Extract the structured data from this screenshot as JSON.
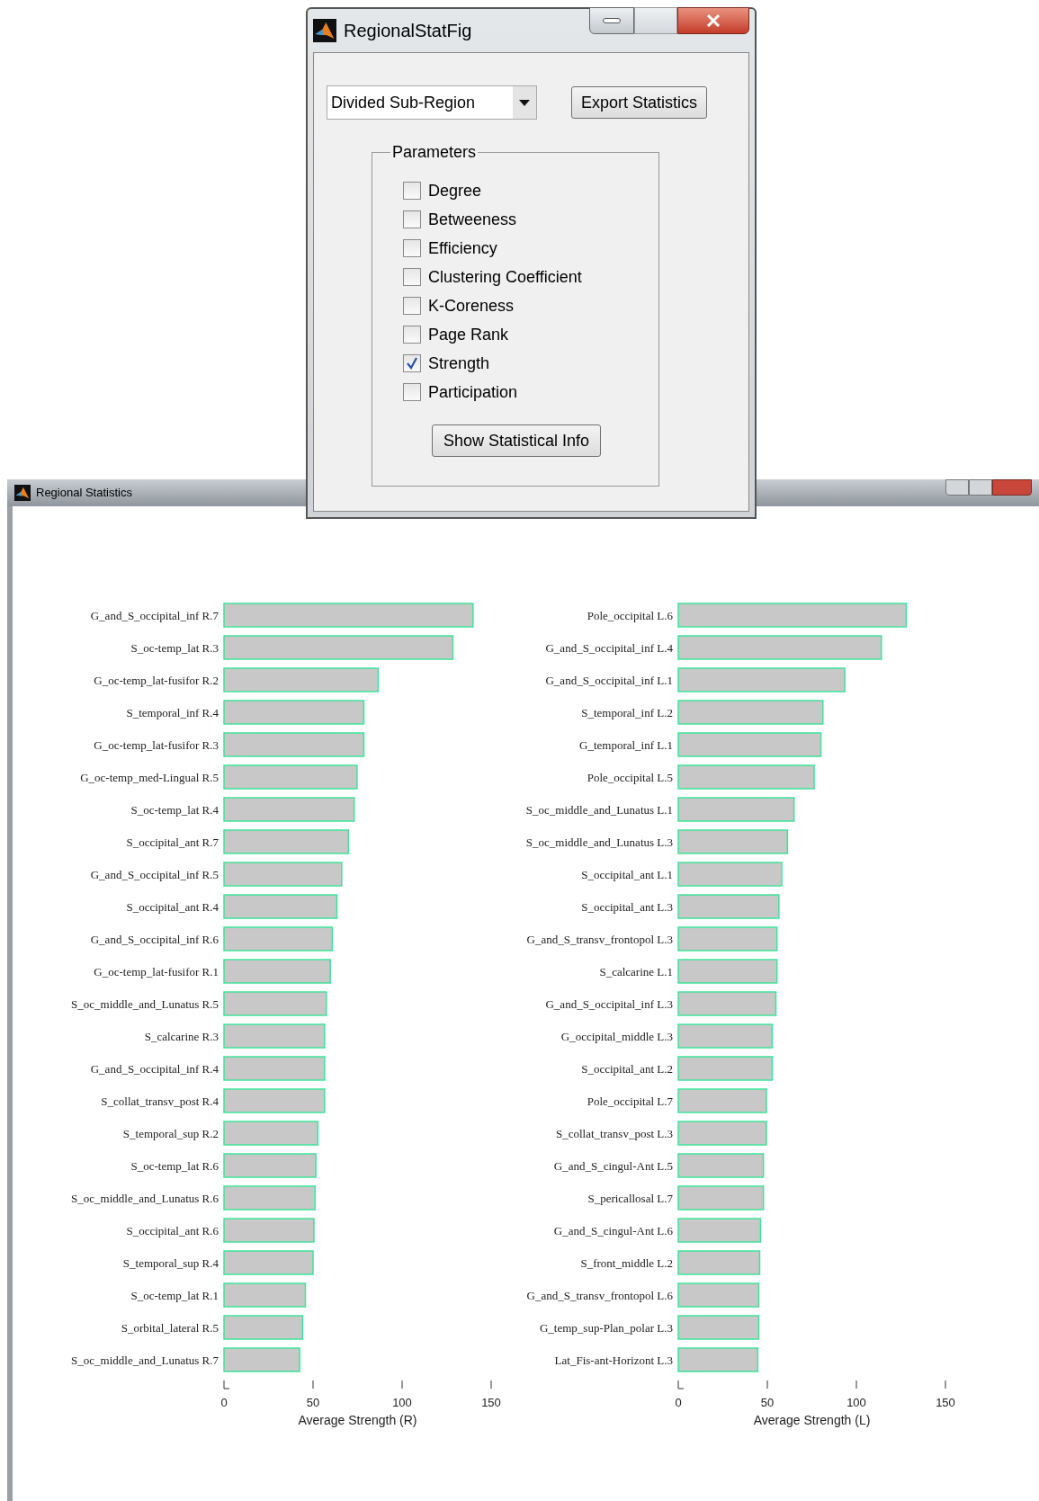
{
  "back_window": {
    "title": "Regional Statistics"
  },
  "dialog": {
    "title": "RegionalStatFig",
    "dropdown": {
      "value": "Divided Sub-Region"
    },
    "export_button": "Export Statistics",
    "group_title": "Parameters",
    "parameters": [
      {
        "label": "Degree",
        "checked": false
      },
      {
        "label": "Betweeness",
        "checked": false
      },
      {
        "label": "Efficiency",
        "checked": false
      },
      {
        "label": "Clustering Coefficient",
        "checked": false
      },
      {
        "label": "K-Coreness",
        "checked": false
      },
      {
        "label": "Page Rank",
        "checked": false
      },
      {
        "label": "Strength",
        "checked": true
      },
      {
        "label": "Participation",
        "checked": false
      }
    ],
    "show_button": "Show Statistical Info"
  },
  "charts": [
    {
      "chart_data": {
        "type": "bar",
        "orientation": "horizontal",
        "xlabel": "Average Strength (R)",
        "xlim": [
          0,
          150
        ],
        "xticks": [
          0,
          50,
          100,
          150
        ],
        "categories": [
          "G_and_S_occipital_inf R.7",
          "S_oc-temp_lat R.3",
          "G_oc-temp_lat-fusifor R.2",
          "S_temporal_inf R.4",
          "G_oc-temp_lat-fusifor R.3",
          "G_oc-temp_med-Lingual R.5",
          "S_oc-temp_lat R.4",
          "S_occipital_ant R.7",
          "G_and_S_occipital_inf R.5",
          "S_occipital_ant R.4",
          "G_and_S_occipital_inf R.6",
          "G_oc-temp_lat-fusifor R.1",
          "S_oc_middle_and_Lunatus R.5",
          "S_calcarine R.3",
          "G_and_S_occipital_inf R.4",
          "S_collat_transv_post R.4",
          "S_temporal_sup R.2",
          "S_oc-temp_lat R.6",
          "S_oc_middle_and_Lunatus R.6",
          "S_occipital_ant R.6",
          "S_temporal_sup R.4",
          "S_oc-temp_lat R.1",
          "S_orbital_lateral R.5",
          "S_oc_middle_and_Lunatus R.7"
        ],
        "series": [
          {
            "color": "#c8c8c8",
            "values": [
              139.8,
              128.5,
              86.6,
              78.5,
              78.5,
              74.7,
              73.1,
              69.9,
              66.1,
              63.4,
              60.8,
              59.7,
              57.5,
              56.5,
              56.5,
              56.5,
              52.7,
              51.6,
              51.1,
              50.5,
              50.0,
              45.7,
              44.1,
              42.5
            ]
          }
        ]
      }
    },
    {
      "chart_data": {
        "type": "bar",
        "orientation": "horizontal",
        "xlabel": "Average Strength (L)",
        "xlim": [
          0,
          150
        ],
        "xticks": [
          0,
          50,
          100,
          150
        ],
        "categories": [
          "Pole_occipital L.6",
          "G_and_S_occipital_inf L.4",
          "G_and_S_occipital_inf L.1",
          "S_temporal_inf L.2",
          "G_temporal_inf L.1",
          "Pole_occipital L.5",
          "S_oc_middle_and_Lunatus L.1",
          "S_oc_middle_and_Lunatus L.3",
          "S_occipital_ant L.1",
          "S_occipital_ant L.3",
          "G_and_S_transv_frontopol L.3",
          "S_calcarine L.1",
          "G_and_S_occipital_inf L.3",
          "G_occipital_middle L.3",
          "S_occipital_ant L.2",
          "Pole_occipital L.7",
          "S_collat_transv_post L.3",
          "G_and_S_cingul-Ant L.5",
          "S_pericallosal L.7",
          "G_and_S_cingul-Ant L.6",
          "S_front_middle L.2",
          "G_and_S_transv_frontopol L.6",
          "G_temp_sup-Plan_polar L.3",
          "Lat_Fis-ant-Horizont L.3"
        ],
        "series": [
          {
            "color": "#c8c8c8",
            "values": [
              128.0,
              114.0,
              93.5,
              81.2,
              80.1,
              76.3,
              65.0,
              61.3,
              58.1,
              56.5,
              55.4,
              55.4,
              54.8,
              52.7,
              52.7,
              49.5,
              49.5,
              47.8,
              47.8,
              46.2,
              45.7,
              45.2,
              45.2,
              44.6
            ]
          }
        ]
      }
    }
  ]
}
